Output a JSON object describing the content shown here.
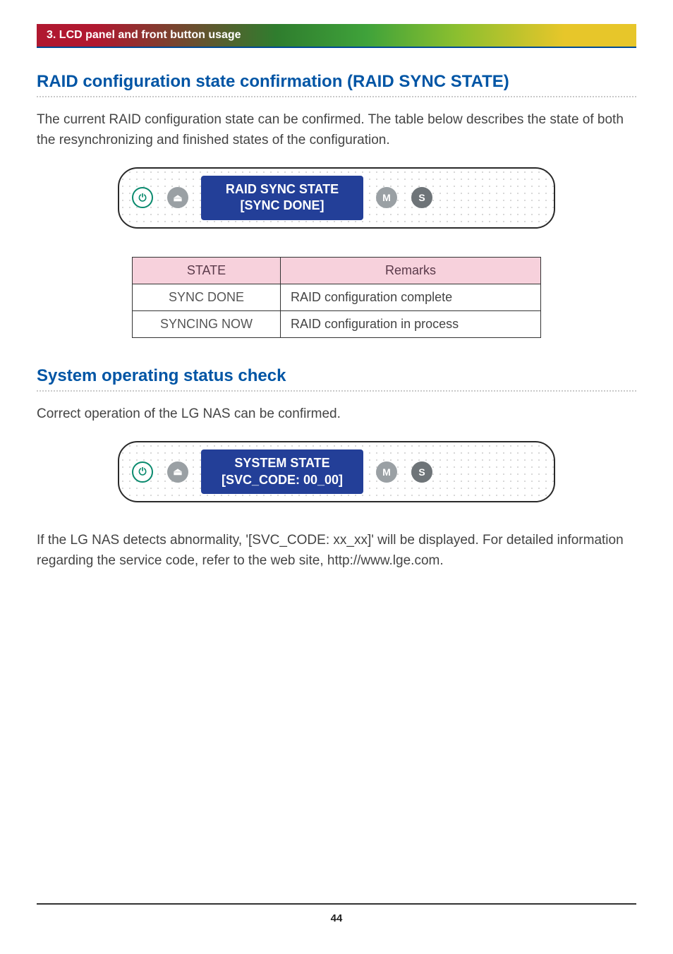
{
  "header": {
    "chapter": "3. LCD panel and front button usage"
  },
  "section1": {
    "title": "RAID configuration state confirmation (RAID SYNC STATE)",
    "para": "The current RAID configuration state can be confirmed. The table below describes the state of both the resynchronizing and finished states of the configuration.",
    "lcd": {
      "line1": "RAID SYNC STATE",
      "line2": "[SYNC DONE]"
    },
    "table": {
      "headers": {
        "state": "STATE",
        "remarks": "Remarks"
      },
      "rows": [
        {
          "state": "SYNC DONE",
          "remarks": "RAID configuration complete"
        },
        {
          "state": "SYNCING NOW",
          "remarks": "RAID configuration in process"
        }
      ]
    }
  },
  "section2": {
    "title": "System operating status check",
    "para1": "Correct operation of the LG NAS can be confirmed.",
    "lcd": {
      "line1": "SYSTEM STATE",
      "line2": "[SVC_CODE: 00_00]"
    },
    "para2": "If the LG NAS detects abnormality, '[SVC_CODE: xx_xx]' will be displayed. For detailed information regarding the service code, refer to the web site, http://www.lge.com."
  },
  "icons": {
    "power": "⏻",
    "eject": "⏏",
    "m": "M",
    "s": "S"
  },
  "page_number": "44"
}
